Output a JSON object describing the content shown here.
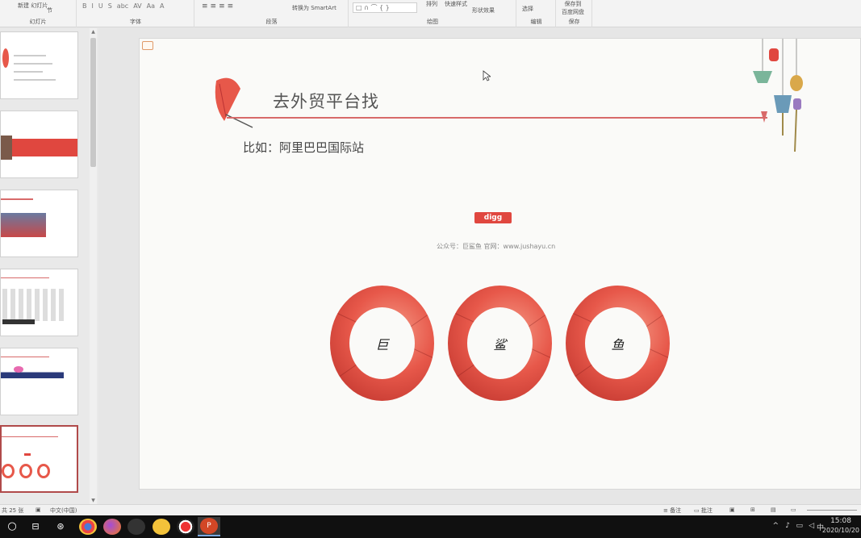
{
  "ribbon": {
    "new_slide": "新建\n幻灯片",
    "section": "节",
    "groups": {
      "slides": "幻灯片",
      "font": "字体",
      "paragraph": "段落",
      "drawing": "绘图",
      "editing": "编辑",
      "save": "保存"
    },
    "format_buttons": [
      "B",
      "I",
      "U",
      "S",
      "abc",
      "AV",
      "Aa",
      "A"
    ],
    "convert_smartart": "转换为 SmartArt",
    "arrange": "排列",
    "quick_styles": "快速样式",
    "shape_effects": "形状效果",
    "select": "选择",
    "save_to_baidu": "保存到\n百度网盘"
  },
  "thumbnails": {
    "count": 6,
    "selected_index": 5
  },
  "slide": {
    "title": "去外贸平台找",
    "subtitle": "比如：阿里巴巴国际站",
    "logo_text": "digg",
    "caption": "公众号：巨鲨鱼  官网：www.jushayu.cn",
    "rings": [
      "巨",
      "鲨",
      "鱼"
    ]
  },
  "statusbar": {
    "slide_count": "共 25 张",
    "language": "中文(中国)",
    "notes": "备注",
    "comments": "批注"
  },
  "taskbar": {
    "time": "15:08",
    "date": "2020/10/20",
    "ime": "中"
  },
  "colors": {
    "accent": "#d86a6a",
    "ring_red": "#e7584a",
    "logo_red": "#e0473f"
  }
}
